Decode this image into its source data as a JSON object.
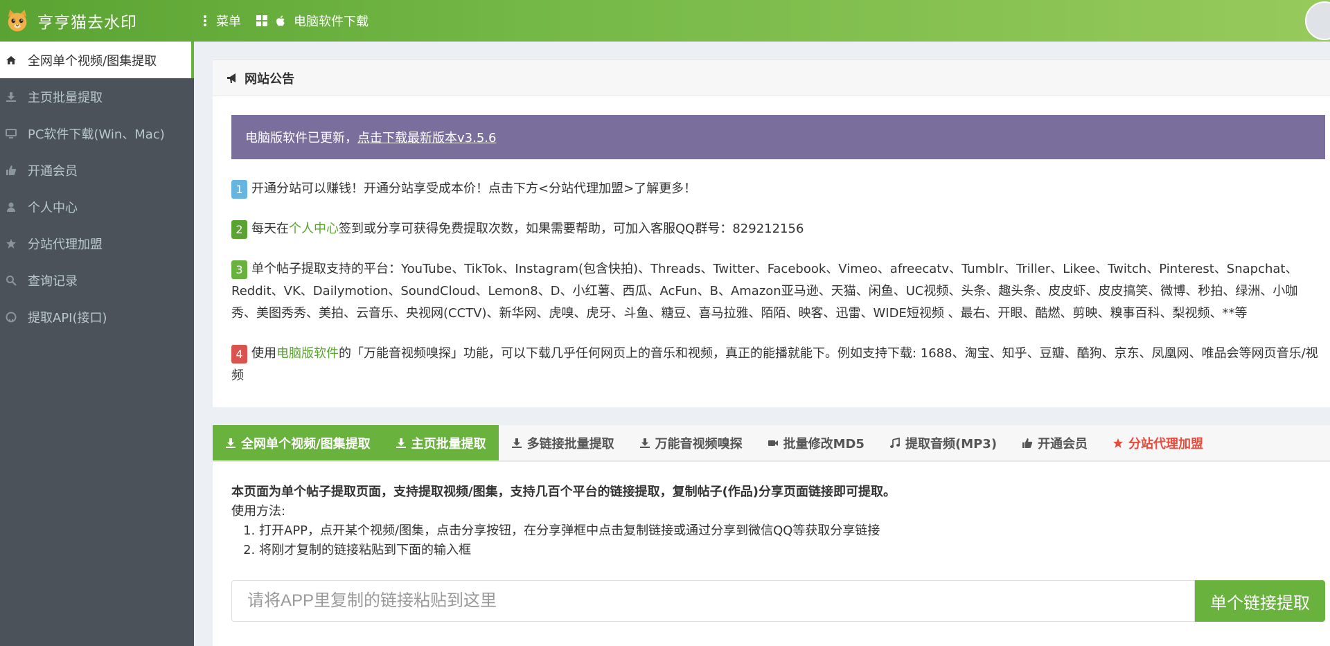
{
  "header": {
    "brand": "亨亨猫去水印",
    "menu_label": "菜单",
    "download_label": "电脑软件下载"
  },
  "sidebar": {
    "items": [
      {
        "label": "全网单个视频/图集提取",
        "icon": "home-icon"
      },
      {
        "label": "主页批量提取",
        "icon": "download-icon"
      },
      {
        "label": "PC软件下载(Win、Mac)",
        "icon": "desktop-icon"
      },
      {
        "label": "开通会员",
        "icon": "thumbs-up-icon"
      },
      {
        "label": "个人中心",
        "icon": "user-icon"
      },
      {
        "label": "分站代理加盟",
        "icon": "star-icon"
      },
      {
        "label": "查询记录",
        "icon": "search-icon"
      },
      {
        "label": "提取API(接口)",
        "icon": "github-icon"
      }
    ]
  },
  "notice": {
    "title": "网站公告",
    "alert_text": "电脑版软件已更新，",
    "alert_link": "点击下载最新版本v3.5.6",
    "items": [
      {
        "num": "1",
        "text": "开通分站可以赚钱！开通分站享受成本价！点击下方<分站代理加盟>了解更多！"
      },
      {
        "num": "2",
        "pre": "每天在",
        "link": "个人中心",
        "text": "签到或分享可获得免费提取次数，如果需要帮助，可加入客服QQ群号：829212156"
      },
      {
        "num": "3",
        "text": "单个帖子提取支持的平台：YouTube、TikTok、Instagram(包含快拍)、Threads、Twitter、Facebook、Vimeo、afreecatv、Tumblr、Triller、Likee、Twitch、Pinterest、Snapchat、Reddit、VK、Dailymotion、SoundCloud、Lemon8、D、小红薯、西瓜、AcFun、B、Amazon亚马逊、天猫、闲鱼、UC视频、头条、趣头条、皮皮虾、皮皮搞笑、微博、秒拍、绿洲、小咖秀、美图秀秀、美拍、云音乐、央视网(CCTV)、新华网、虎嗅、虎牙、斗鱼、糖豆、喜马拉雅、陌陌、映客、迅雷、WIDE短视频 、最右、开眼、酷燃、剪映、糗事百科、梨视频、**等"
      },
      {
        "num": "4",
        "pre": "使用",
        "link": "电脑版软件",
        "text": "的「万能音视频嗅探」功能，可以下载几乎任何网页上的音乐和视频，真正的能播就能下。例如支持下载: 1688、淘宝、知乎、豆瓣、酷狗、京东、凤凰网、唯品会等网页音乐/视频"
      }
    ]
  },
  "tabs": [
    {
      "label": "全网单个视频/图集提取",
      "icon": "download-icon"
    },
    {
      "label": "主页批量提取",
      "icon": "download-icon"
    },
    {
      "label": "多链接批量提取",
      "icon": "download-icon"
    },
    {
      "label": "万能音视频嗅探",
      "icon": "download-icon"
    },
    {
      "label": "批量修改MD5",
      "icon": "video-camera-icon"
    },
    {
      "label": "提取音频(MP3)",
      "icon": "music-icon"
    },
    {
      "label": "开通会员",
      "icon": "thumbs-up-icon"
    },
    {
      "label": "分站代理加盟",
      "icon": "star-icon"
    }
  ],
  "extract": {
    "lead": "本页面为单个帖子提取页面，支持提取视频/图集，支持几百个平台的链接提取，复制帖子(作品)分享页面链接即可提取。",
    "usage_title": "使用方法:",
    "steps": [
      "打开APP，点开某个视频/图集，点击分享按钮，在分享弹框中点击复制链接或通过分享到微信QQ等获取分享链接",
      "将刚才复制的链接粘贴到下面的输入框"
    ],
    "input_placeholder": "请将APP里复制的链接粘贴到这里",
    "input_value": "",
    "button_label": "单个链接提取"
  },
  "colors": {
    "brand_green": "#6ab23e",
    "sidebar_bg": "#4b525a",
    "alert_purple": "#7a6e9c",
    "accent_red": "#e74c3c"
  }
}
